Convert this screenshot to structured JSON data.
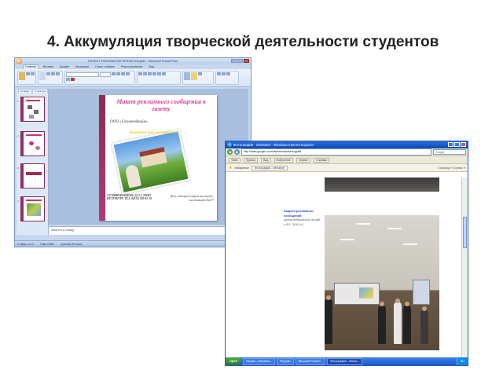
{
  "heading": "4. Аккумуляция творческой деятельности студентов",
  "powerpoint": {
    "window_title": "ПРОЕКТ РЕКЛАМНОЙ ПРЕЗЕНТАЦИИ - Microsoft PowerPoint",
    "ribbon_tabs": [
      "Главная",
      "Вставка",
      "Дизайн",
      "Анимация",
      "Показ слайдов",
      "Рецензирование",
      "Вид"
    ],
    "side_tabs": [
      "Слайды",
      "Структура"
    ],
    "thumbnail_numbers": [
      "1",
      "2",
      "3",
      "4"
    ],
    "slide": {
      "title": "Макет рекламного сообщения в газету",
      "company": "ООО «Сельтендвайм»",
      "slogan": "Найдется дом для каждого!",
      "address": "УЛ.МИНЕРАЛЬНАЯ, Д.15, САНКТ-ПЕТЕРБУРГ, ТЕЛ. 8(812) 290-81-18",
      "note": "Дом, который уверен вы ищете, настоящий дом!!!"
    },
    "notes_placeholder": "Заметки к слайду",
    "status": [
      "Слайд 1 из 4",
      "Тема Office",
      "русский (Россия)"
    ]
  },
  "browser": {
    "window_title": "Фотографии - ietmarket - Windows Internet Explorer",
    "url": "http://sites.google.com/site/ietmarket/fotografii",
    "search_placeholder": "Google",
    "menu": [
      "Файл",
      "Правка",
      "Вид",
      "Избранное",
      "Сервис",
      "Справка"
    ],
    "favorites_label": "Избранное",
    "tab_label": "Фотографии - ietmarket",
    "right_tools": "Страница ▾  Сервис ▾",
    "caption_title": "Защита рекламных сообщений",
    "caption_body": "(Александровский лицей, г.Ф1, 2010 г.)",
    "taskbar_start": "пуск",
    "taskbar_tasks": [
      "Лекция - ietmarket...",
      "Рисунки",
      "Microsoft PowerP...",
      "Фотографии - ietmar..."
    ],
    "tray": "RU"
  }
}
